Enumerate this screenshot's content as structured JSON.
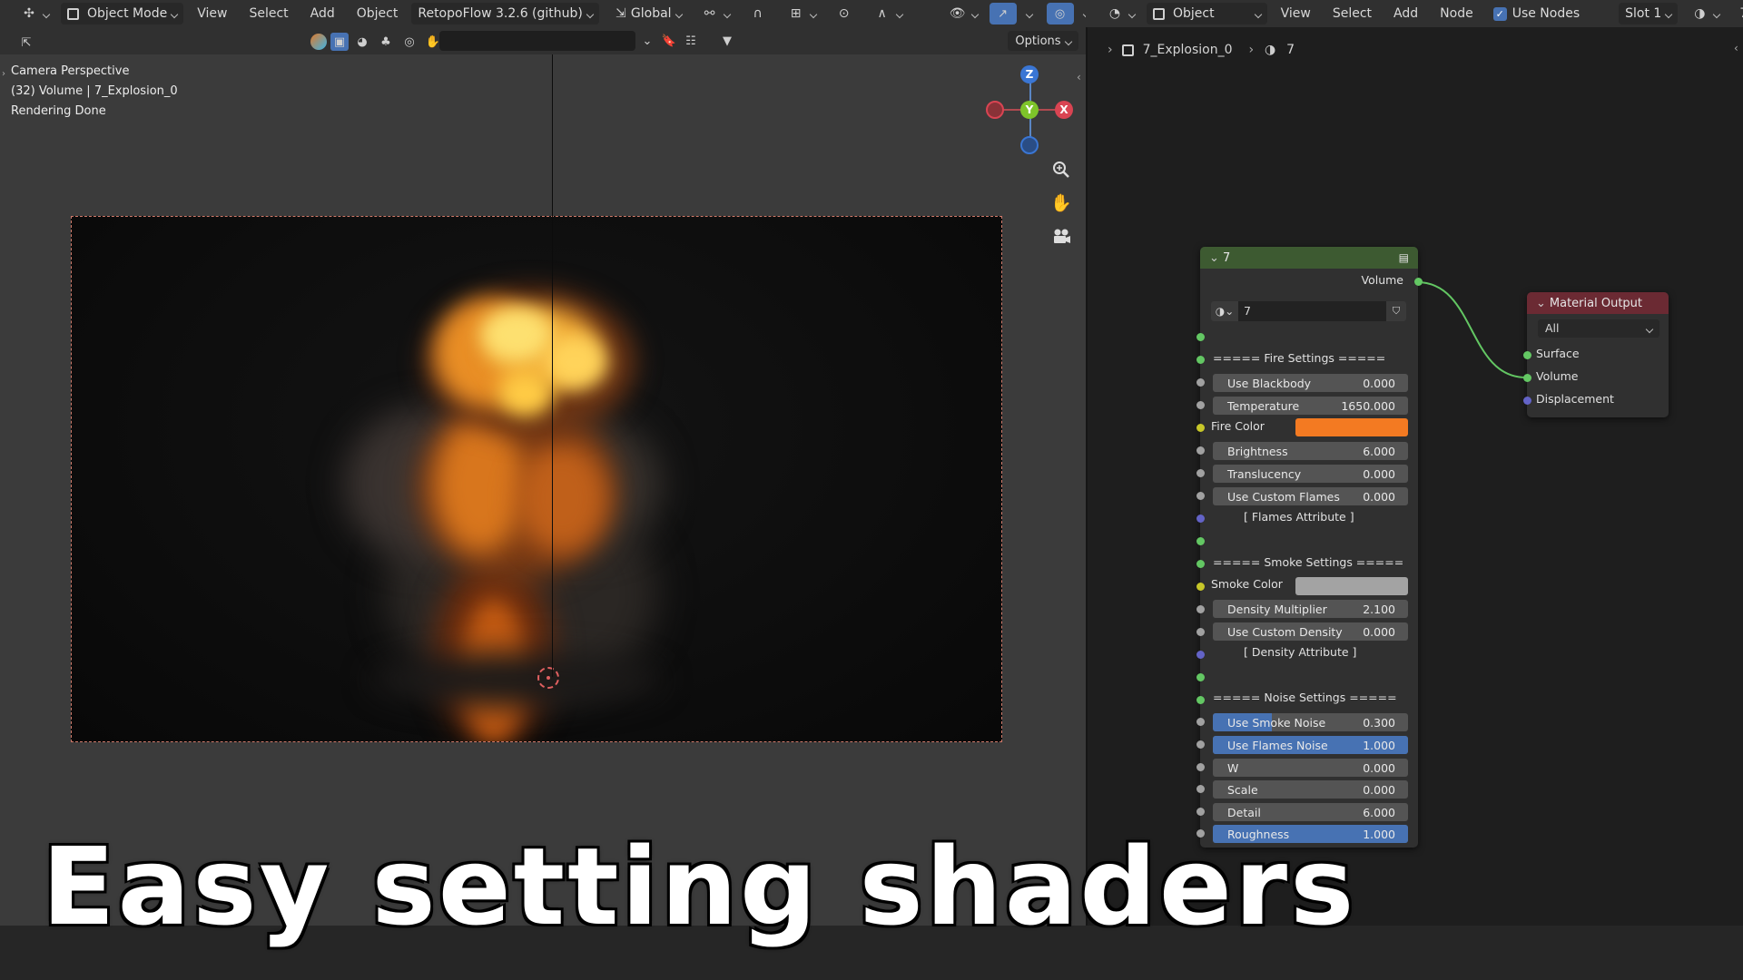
{
  "viewport_header": {
    "mode": "Object Mode",
    "menus": [
      "View",
      "Select",
      "Add",
      "Object"
    ],
    "addon": "RetopoFlow 3.2.6 (github)",
    "orientation": "Global"
  },
  "viewport_header2": {
    "options": "Options"
  },
  "viewport": {
    "info_lines": [
      "Camera Perspective",
      "(32) Volume | 7_Explosion_0",
      "Rendering Done"
    ],
    "gizmo": {
      "z": "Z",
      "y": "Y",
      "x": "X"
    }
  },
  "node_header": {
    "mode": "Object",
    "menus": [
      "View",
      "Select",
      "Add",
      "Node"
    ],
    "use_nodes": "Use Nodes",
    "slot": "Slot 1",
    "material": "7"
  },
  "breadcrumb": {
    "object": "7_Explosion_0",
    "material": "7"
  },
  "group_node": {
    "title": "7",
    "output_label": "Volume",
    "datablock": "7",
    "fire_header": "===== Fire  Settings  =====",
    "fields_fire": [
      {
        "label": "Use Blackbody",
        "value": "0.000"
      },
      {
        "label": "Temperature",
        "value": "1650.000"
      }
    ],
    "fire_color_label": "Fire Color",
    "fire_color": "#f37a22",
    "fields_fire2": [
      {
        "label": "Brightness",
        "value": "6.000"
      },
      {
        "label": "Translucency",
        "value": "0.000"
      },
      {
        "label": "Use Custom Flames",
        "value": "0.000"
      }
    ],
    "flames_attr": "[ Flames Attribute ]",
    "smoke_header": "===== Smoke Settings =====",
    "smoke_color_label": "Smoke Color",
    "smoke_color": "#a3a3a3",
    "fields_smoke": [
      {
        "label": "Density Multiplier",
        "value": "2.100"
      },
      {
        "label": "Use Custom Density",
        "value": "0.000"
      }
    ],
    "density_attr": "[ Density Attribute ]",
    "noise_header": "=====  Noise Settings  =====",
    "fields_noise": [
      {
        "label": "Use Smoke Noise",
        "value": "0.300",
        "fill": 0.3
      },
      {
        "label": "Use Flames Noise",
        "value": "1.000",
        "fill": 1.0
      },
      {
        "label": "W",
        "value": "0.000",
        "fill": 0
      },
      {
        "label": "Scale",
        "value": "0.000",
        "fill": 0
      },
      {
        "label": "Detail",
        "value": "6.000",
        "fill": 0
      },
      {
        "label": "Roughness",
        "value": "1.000",
        "fill": 1.0
      }
    ]
  },
  "material_output": {
    "title": "Material Output",
    "target": "All",
    "inputs": [
      "Surface",
      "Volume",
      "Displacement"
    ]
  },
  "caption": "Easy setting shaders",
  "colors": {
    "group_header": "#3d5a31",
    "output_header": "#6b2a33",
    "accent": "#4772b3"
  }
}
